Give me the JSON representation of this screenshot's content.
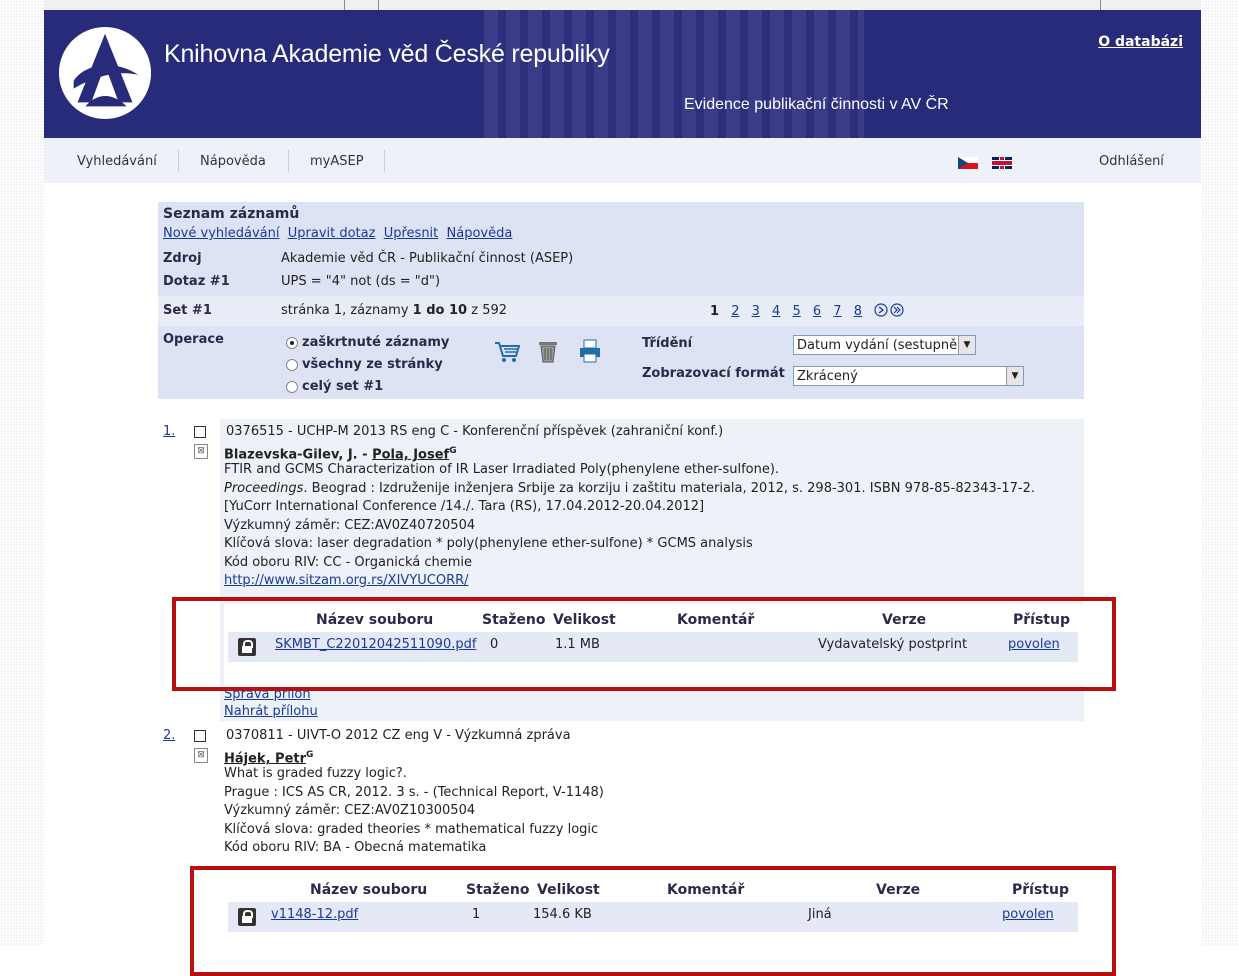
{
  "header": {
    "title": "Knihovna Akademie věd České republiky",
    "subtitle": "Evidence publikační činnosti v AV ČR",
    "about_link": "O databázi"
  },
  "nav": {
    "items": [
      "Vyhledávání",
      "Nápověda",
      "myASEP"
    ],
    "logout": "Odhlášení",
    "flags": [
      "cz-flag-icon",
      "gb-flag-icon"
    ]
  },
  "list": {
    "title": "Seznam záznamů",
    "links": [
      "Nové vyhledávání",
      "Upravit dotaz",
      "Upřesnit",
      "Nápověda"
    ],
    "source_label": "Zdroj",
    "source_value": "Akademie věd ČR - Publikační činnost (ASEP)",
    "query_label": "Dotaz #1",
    "query_value": "UPS = \"4\" not (ds = \"d\")",
    "set_label": "Set #1",
    "set_prefix": "stránka 1, záznamy",
    "set_range": "1 do 10",
    "set_suffix": "z 592",
    "pages": [
      "1",
      "2",
      "3",
      "4",
      "5",
      "6",
      "7",
      "8"
    ],
    "current_page": "1",
    "ops_label": "Operace",
    "ops_options": [
      "zaškrtnuté záznamy",
      "všechny ze stránky",
      "celý set #1"
    ],
    "sort_label": "Třídění",
    "sort_value": "Datum vydání (sestupně",
    "format_label": "Zobrazovací formát",
    "format_value": "Zkrácený",
    "icons": [
      "cart-icon",
      "trash-icon",
      "print-icon",
      "next-page-icon",
      "last-page-icon"
    ]
  },
  "records": [
    {
      "num": "1.",
      "line1": "0376515 - UCHP-M 2013 RS eng C - Konferenční příspěvek (zahraniční konf.)",
      "author1": "Blazevska-Gilev, J.",
      "author_sep": " - ",
      "author2": "Pola, Josef",
      "sup": "G",
      "title": "FTIR and GCMS Characterization of IR Laser Irradiated Poly(phenylene ether-sulfone).",
      "source_italic": "Proceedings",
      "source_rest": ". Beograd : Izdruženije inženjera Srbije za korziju i zaštitu materiala, 2012, s. 298-301. ISBN 978-85-82343-17-2.",
      "conf": "[YuCorr International Conference /14./. Tara (RS), 17.04.2012-20.04.2012]",
      "zamer": "Výzkumný záměr: CEZ:AV0Z40720504",
      "keywords": "Klíčová slova: laser degradation * poly(phenylene ether-sulfone) * GCMS analysis",
      "riv": "Kód oboru RIV: CC - Organická chemie",
      "url": "http://www.sitzam.org.rs/XIVYUCORR/",
      "manage": "Správa příloh",
      "upload": "Nahrát přílohu",
      "attach_headers": [
        "Název souboru",
        "Staženo",
        "Velikost",
        "Komentář",
        "Verze",
        "Přístup"
      ],
      "file": "SKMBT_C22012042511090.pdf",
      "downloads": "0",
      "size": "1.1 MB",
      "comment": "",
      "version": "Vydavatelský postprint",
      "access": "povolen"
    },
    {
      "num": "2.",
      "line1": "0370811 - UIVT-O 2012 CZ eng V - Výzkumná zpráva",
      "author1": "Hájek, Petr",
      "sup": "G",
      "title": "What is graded fuzzy logic?.",
      "source_rest": "Prague : ICS AS CR, 2012. 3 s. - (Technical Report, V-1148)",
      "zamer": "Výzkumný záměr: CEZ:AV0Z10300504",
      "keywords": "Klíčová slova: graded theories * mathematical fuzzy logic",
      "riv": "Kód oboru RIV: BA - Obecná matematika",
      "attach_headers": [
        "Název souboru",
        "Staženo",
        "Velikost",
        "Komentář",
        "Verze",
        "Přístup"
      ],
      "file": "v1148-12.pdf",
      "downloads": "1",
      "size": "154.6 KB",
      "comment": "",
      "version": "Jiná",
      "access": "povolen"
    }
  ],
  "colors": {
    "header_bg": "#282a7a",
    "panel_bg": "#dde3f2",
    "highlight_box": "#b80f0f",
    "link": "#1a3a9a"
  }
}
